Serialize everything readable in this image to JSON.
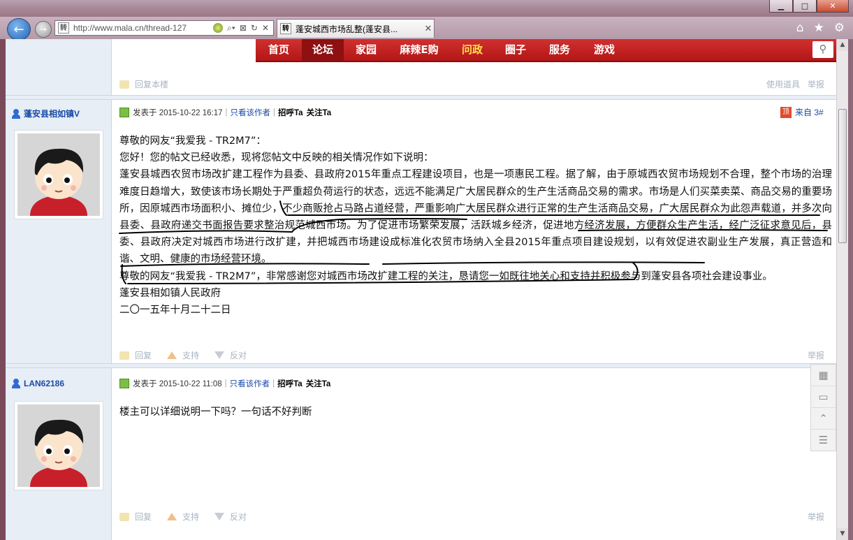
{
  "browser": {
    "url": "http://www.mala.cn/thread-127",
    "favicon_text": "转",
    "tab_title": "蓬安城西市场乱整(蓬安县...",
    "icons": {
      "back": "back-arrow-icon",
      "forward": "forward-arrow-icon",
      "home": "home-icon",
      "favorites": "star-icon",
      "tools": "gear-icon",
      "close": "close-icon"
    }
  },
  "site_nav": {
    "items": [
      "首页",
      "论坛",
      "家园",
      "麻辣E购",
      "问政",
      "圈子",
      "服务",
      "游戏"
    ],
    "active": "论坛",
    "highlight": "问政"
  },
  "prev_post": {
    "reply_label": "回复本楼",
    "tools_label": "使用道具",
    "report_label": "举报"
  },
  "posts": [
    {
      "username": "蓬安县相如镇V",
      "posted": "发表于 2015-10-22 16:17",
      "only_author": "只看该作者",
      "greet": "招呼Ta",
      "follow": "关注Ta",
      "top_badge": "顶",
      "floor_label": "来自",
      "floor": "3#",
      "paragraphs": [
        "尊敬的网友“我爱我 - TR2M7”：",
        "您好！您的帖文已经收悉，现将您帖文中反映的相关情况作如下说明：",
        "蓬安县城西农贸市场改扩建工程作为县委、县政府2015年重点工程建设项目，也是一项惠民工程。据了解，由于原城西农贸市场规划不合理，整个市场的治理难度日趋增大，致使该市场长期处于严重超负荷运行的状态，远远不能满足广大居民群众的生产生活商品交易的需求。市场是人们买菜卖菜、商品交易的重要场所，因原城西市场面积小、摊位少，不少商贩抢占马路占道经营，严重影响广大居民群众进行正常的生产生活商品交易，广大居民群众为此怨声载道，并多次向县委、县政府递交书面报告要求整治规范城西市场。为了促进市场繁荣发展，活跃城乡经济，促进地方经济发展，方便群众生产生活，经广泛征求意见后，县委、县政府决定对城西市场进行改扩建，并把城西市场建设成标准化农贸市场纳入全县2015年重点项目建设规划，以有效促进农副业生产发展，真正营造和谐、文明、健康的市场经营环境。",
        "尊敬的网友“我爱我 - TR2M7”，非常感谢您对城西市场改扩建工程的关注，恳请您一如既往地关心和支持并积极参与到蓬安县各项社会建设事业。",
        "蓬安县相如镇人民政府",
        "二〇一五年十月二十二日"
      ],
      "actions": [
        "回复",
        "支持",
        "反对"
      ],
      "report": "举报"
    },
    {
      "username": "LAN62186",
      "posted": "发表于 2015-10-22 11:08",
      "only_author": "只看该作者",
      "greet": "招呼Ta",
      "follow": "关注Ta",
      "paragraphs": [
        "楼主可以详细说明一下吗？一句话不好判断"
      ],
      "actions": [
        "回复",
        "支持",
        "反对"
      ],
      "report": "举报"
    }
  ],
  "side_tools": [
    "qrcode-icon",
    "comment-icon",
    "back-to-top-icon",
    "list-icon"
  ],
  "colors": {
    "nav_red": "#c41f1f",
    "link_blue": "#1a4aa6",
    "sidebar_bg": "#e7eef6",
    "highlight_yellow": "#ffe24a"
  }
}
